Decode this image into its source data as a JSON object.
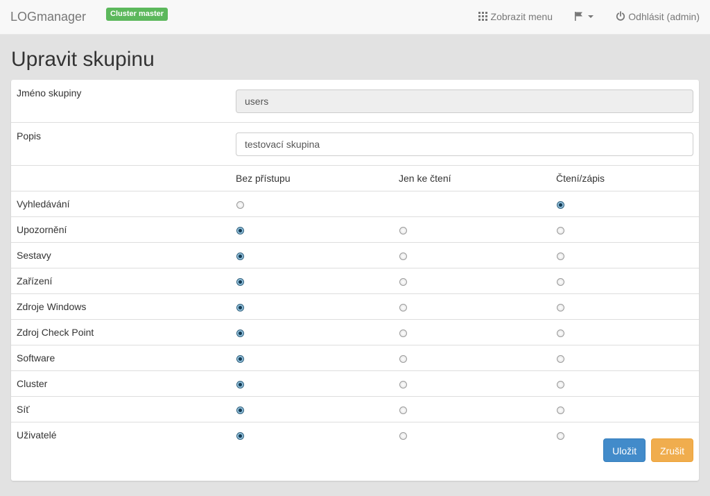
{
  "navbar": {
    "brand": "LOGmanager",
    "badge": "Cluster master",
    "menu_label": "Zobrazit menu",
    "logout_label": "Odhlásit (admin)"
  },
  "page": {
    "title": "Upravit skupinu"
  },
  "form": {
    "name_label": "Jméno skupiny",
    "name_value": "users",
    "desc_label": "Popis",
    "desc_value": "testovací skupina"
  },
  "permissions": {
    "columns": [
      "Bez přístupu",
      "Jen ke čtení",
      "Čtení/zápis"
    ],
    "rows": [
      {
        "label": "Vyhledávání",
        "selected": 2,
        "options": [
          true,
          false,
          true
        ]
      },
      {
        "label": "Upozornění",
        "selected": 0,
        "options": [
          true,
          true,
          true
        ]
      },
      {
        "label": "Sestavy",
        "selected": 0,
        "options": [
          true,
          true,
          true
        ]
      },
      {
        "label": "Zařízení",
        "selected": 0,
        "options": [
          true,
          true,
          true
        ]
      },
      {
        "label": "Zdroje Windows",
        "selected": 0,
        "options": [
          true,
          true,
          true
        ]
      },
      {
        "label": "Zdroj Check Point",
        "selected": 0,
        "options": [
          true,
          true,
          true
        ]
      },
      {
        "label": "Software",
        "selected": 0,
        "options": [
          true,
          true,
          true
        ]
      },
      {
        "label": "Cluster",
        "selected": 0,
        "options": [
          true,
          true,
          true
        ]
      },
      {
        "label": "Síť",
        "selected": 0,
        "options": [
          true,
          true,
          true
        ]
      },
      {
        "label": "Uživatelé",
        "selected": 0,
        "options": [
          true,
          true,
          true
        ]
      }
    ]
  },
  "actions": {
    "save_label": "Uložit",
    "cancel_label": "Zrušit"
  },
  "colors": {
    "save": "#428bca",
    "cancel": "#f0ad4e",
    "badge": "#5cb85c"
  }
}
